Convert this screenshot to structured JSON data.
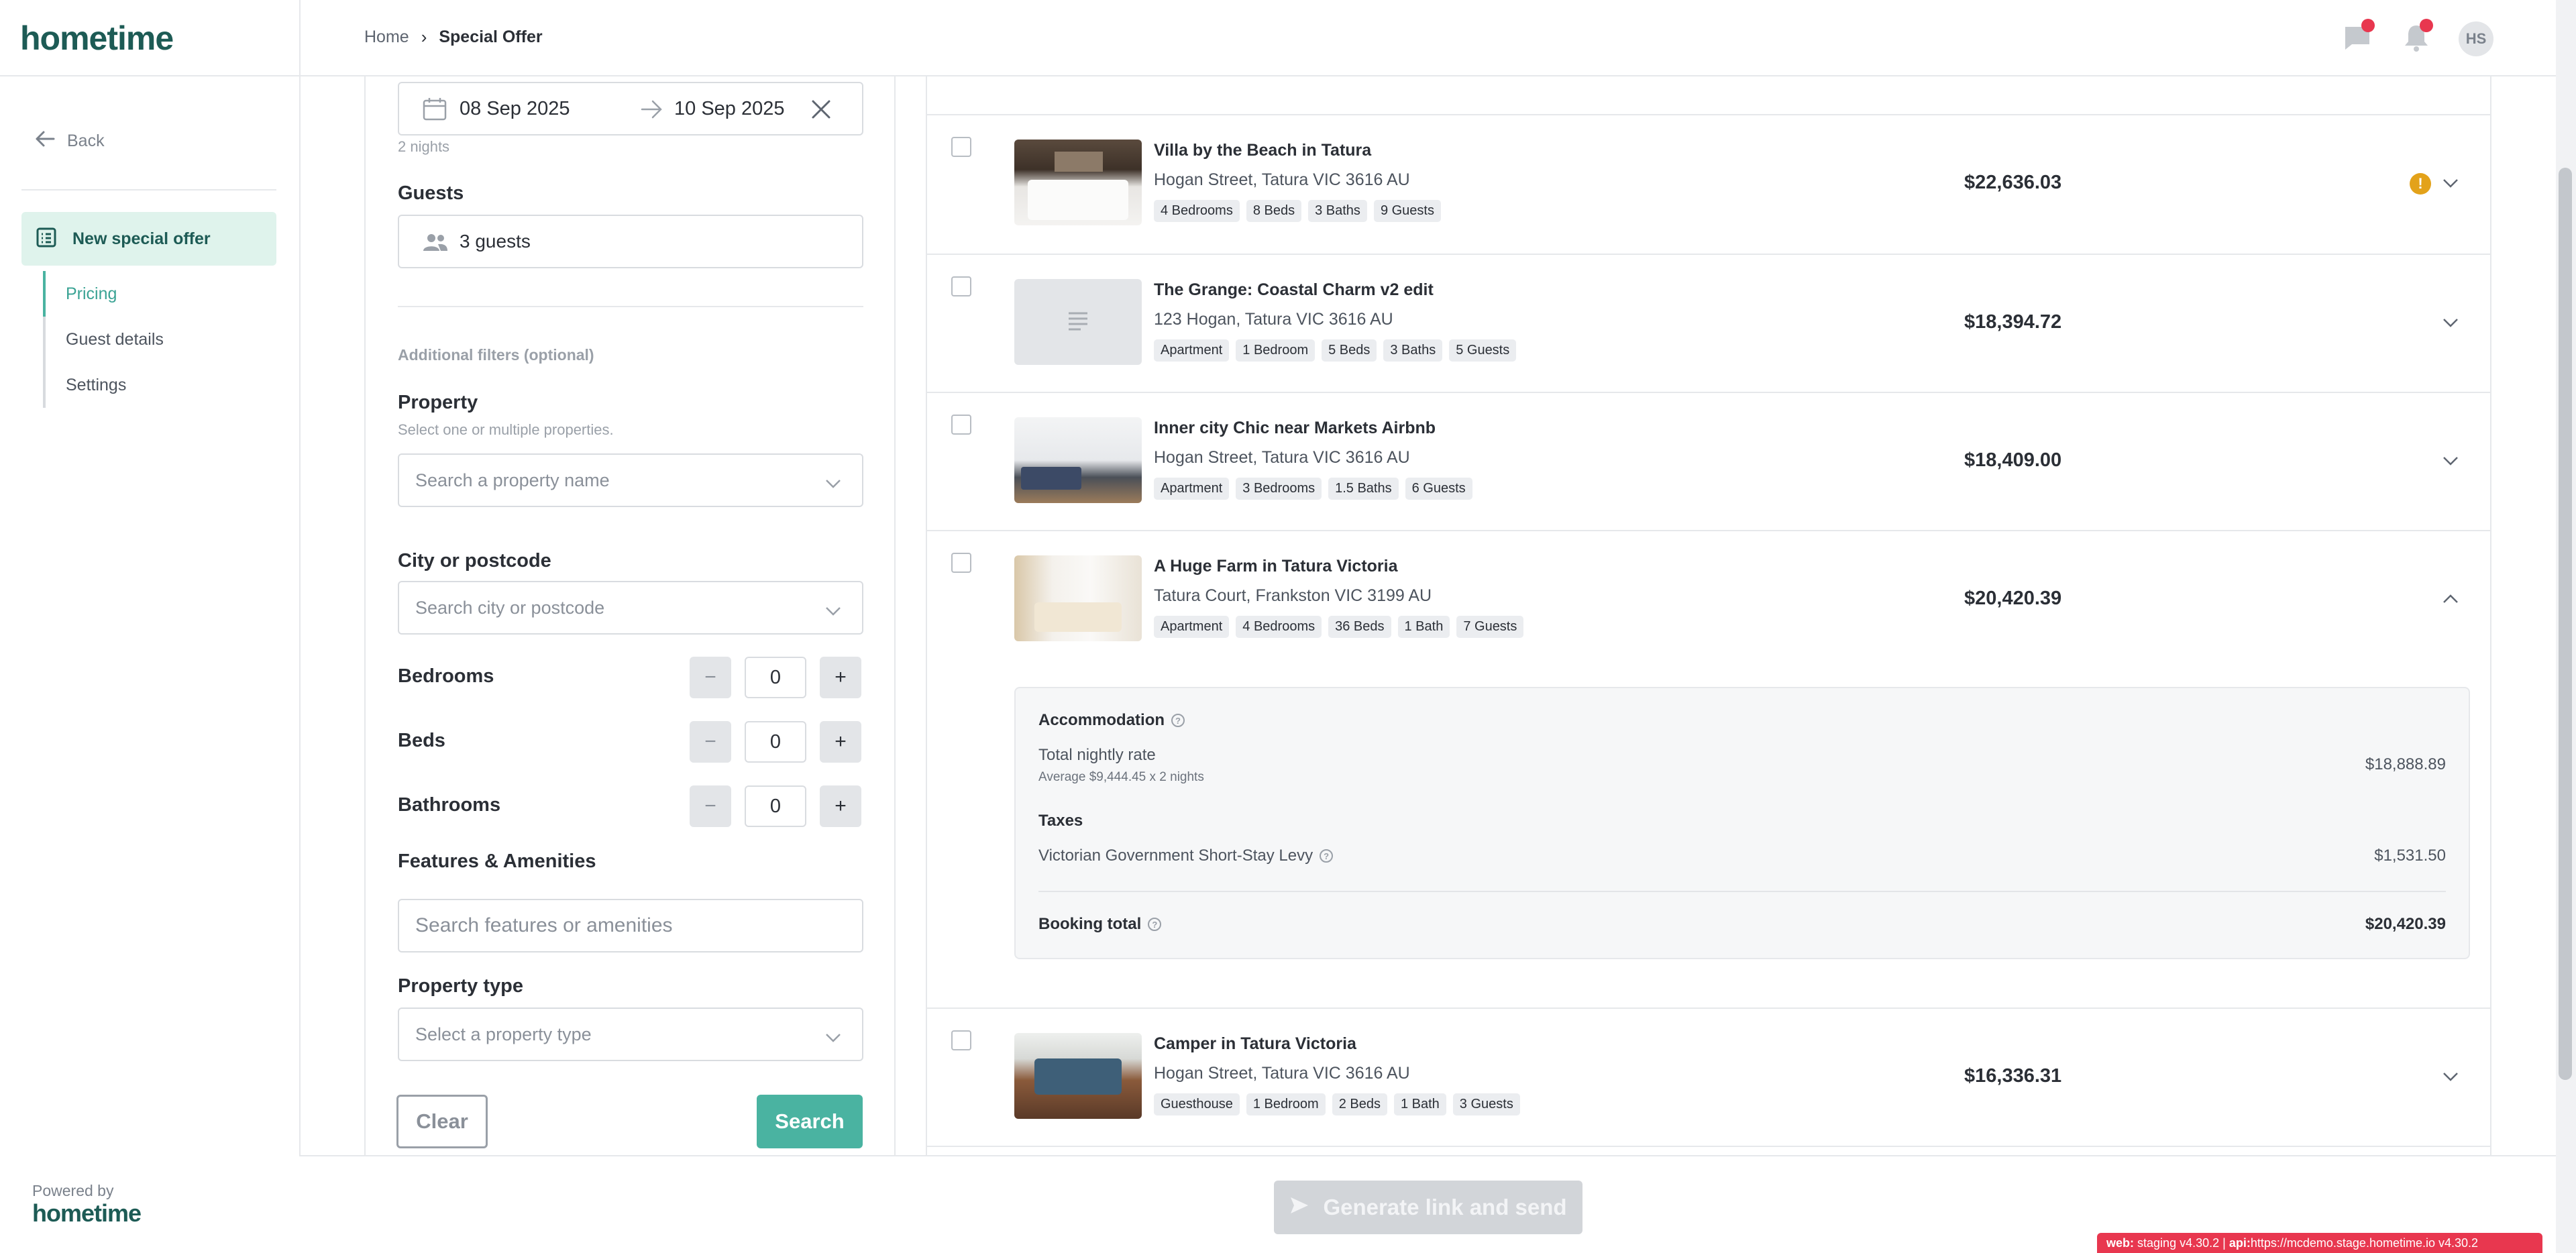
{
  "brand": {
    "logo": "hometime",
    "powered_by": "Powered by"
  },
  "colors": {
    "accent": "#4ab3a1",
    "brand": "#1d5b55",
    "alert": "#e8374f",
    "warning": "#e3a21a"
  },
  "breadcrumb": {
    "home": "Home",
    "separator": "›",
    "current": "Special Offer"
  },
  "header": {
    "avatar_initials": "HS"
  },
  "sidebar": {
    "back": "Back",
    "active_item": "New special offer",
    "subnav": [
      "Pricing",
      "Guest details",
      "Settings"
    ]
  },
  "filters": {
    "date_from": "08 Sep 2025",
    "date_to": "10 Sep 2025",
    "nights": "2 nights",
    "guests_label": "Guests",
    "guests_value": "3 guests",
    "additional_filters": "Additional filters (optional)",
    "property_label": "Property",
    "property_hint": "Select one or multiple properties.",
    "property_placeholder": "Search a property name",
    "city_label": "City or postcode",
    "city_placeholder": "Search city or postcode",
    "bedrooms_label": "Bedrooms",
    "bedrooms_value": "0",
    "beds_label": "Beds",
    "beds_value": "0",
    "bathrooms_label": "Bathrooms",
    "bathrooms_value": "0",
    "minus": "−",
    "plus": "+",
    "features_label": "Features & Amenities",
    "features_placeholder": "Search features or amenities",
    "property_type_label": "Property type",
    "property_type_placeholder": "Select a property type",
    "clear": "Clear",
    "search": "Search"
  },
  "results": [
    {
      "title": "Villa by the Beach in Tatura",
      "address": "Hogan Street, Tatura VIC 3616 AU",
      "tags": [
        "4 Bedrooms",
        "8 Beds",
        "3 Baths",
        "9 Guests"
      ],
      "price": "$22,636.03",
      "warning": "!"
    },
    {
      "title": "The Grange: Coastal Charm v2 edit",
      "address": "123 Hogan, Tatura VIC 3616 AU",
      "tags": [
        "Apartment",
        "1 Bedroom",
        "5 Beds",
        "3 Baths",
        "5 Guests"
      ],
      "price": "$18,394.72"
    },
    {
      "title": "Inner city Chic near Markets Airbnb",
      "address": "Hogan Street, Tatura VIC 3616 AU",
      "tags": [
        "Apartment",
        "3 Bedrooms",
        "1.5 Baths",
        "6 Guests"
      ],
      "price": "$18,409.00"
    },
    {
      "title": "A Huge Farm in Tatura Victoria",
      "address": "Tatura Court, Frankston VIC 3199 AU",
      "tags": [
        "Apartment",
        "4 Bedrooms",
        "36 Beds",
        "1 Bath",
        "7 Guests"
      ],
      "price": "$20,420.39"
    },
    {
      "title": "Camper in Tatura Victoria",
      "address": "Hogan Street, Tatura VIC 3616 AU",
      "tags": [
        "Guesthouse",
        "1 Bedroom",
        "2 Beds",
        "1 Bath",
        "3 Guests"
      ],
      "price": "$16,336.31"
    }
  ],
  "breakdown": {
    "accommodation": "Accommodation",
    "nightly_label": "Total nightly rate",
    "nightly_sub": "Average $9,444.45 x 2 nights",
    "nightly_value": "$18,888.89",
    "taxes": "Taxes",
    "levy_label": "Victorian Government Short-Stay Levy",
    "levy_value": "$1,531.50",
    "total_label": "Booking total",
    "total_value": "$20,420.39",
    "help": "?"
  },
  "footer": {
    "generate": "Generate link and send"
  },
  "env": {
    "web_label": "web:",
    "web_value": "staging v4.30.2",
    "api_label": "api:",
    "api_value": "https://mcdemo.stage.hometime.io v4.30.2",
    "sep": "|"
  }
}
